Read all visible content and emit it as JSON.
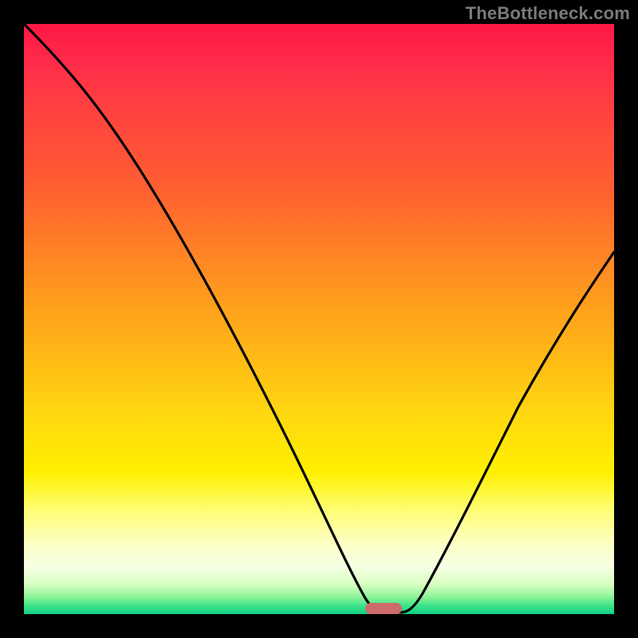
{
  "watermark": "TheBottleneck.com",
  "colors": {
    "background": "#000000",
    "gradient_top": "#ff1744",
    "gradient_mid": "#ffd710",
    "gradient_bottom": "#10d084",
    "curve": "#000000",
    "marker": "#cd6a6a",
    "watermark_text": "#7a7a7a"
  },
  "chart_data": {
    "type": "line",
    "title": "",
    "xlabel": "",
    "ylabel": "",
    "xlim": [
      0,
      100
    ],
    "ylim": [
      0,
      100
    ],
    "grid": false,
    "legend": false,
    "series": [
      {
        "name": "curve",
        "x": [
          0,
          5,
          10,
          15,
          20,
          25,
          30,
          35,
          40,
          45,
          50,
          55,
          58,
          60,
          62,
          64,
          67,
          70,
          75,
          80,
          85,
          90,
          95,
          100
        ],
        "y": [
          100,
          94,
          88,
          82,
          75,
          67,
          58,
          49,
          40,
          31,
          22,
          12,
          4,
          0,
          0,
          1,
          5,
          11,
          22,
          33,
          43,
          51,
          57,
          62
        ]
      }
    ],
    "optimal_marker": {
      "x": 61,
      "width_pct": 6,
      "y": 0
    }
  }
}
